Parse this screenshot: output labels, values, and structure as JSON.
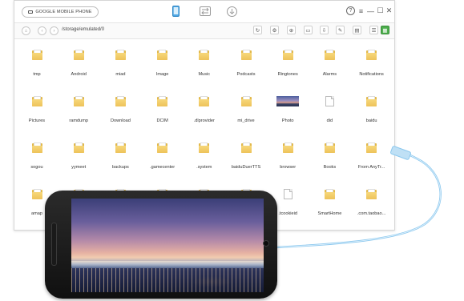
{
  "titlebar": {
    "device_name": "GOOGLE MOBILE PHONE",
    "tabs": [
      {
        "icon": "phone-icon",
        "active": true
      },
      {
        "icon": "transfer-icon",
        "active": false
      },
      {
        "icon": "download-icon",
        "active": false
      }
    ],
    "controls": {
      "help": "?",
      "menu": "≡",
      "minimize": "—",
      "maximize": "☐",
      "close": "✕"
    }
  },
  "pathbar": {
    "path": "/storage/emulated/0"
  },
  "files": [
    {
      "name": "tmp",
      "type": "folder"
    },
    {
      "name": "Android",
      "type": "folder"
    },
    {
      "name": "miad",
      "type": "folder"
    },
    {
      "name": "Image",
      "type": "folder"
    },
    {
      "name": "Music",
      "type": "folder"
    },
    {
      "name": "Podcasts",
      "type": "folder"
    },
    {
      "name": "Ringtones",
      "type": "folder"
    },
    {
      "name": "Alarms",
      "type": "folder"
    },
    {
      "name": "Notifications",
      "type": "folder"
    },
    {
      "name": "Pictures",
      "type": "folder"
    },
    {
      "name": "ramdump",
      "type": "folder"
    },
    {
      "name": "Download",
      "type": "folder"
    },
    {
      "name": "DCIM",
      "type": "folder"
    },
    {
      "name": ".dlprovider",
      "type": "folder"
    },
    {
      "name": "mi_drive",
      "type": "folder"
    },
    {
      "name": "Photo",
      "type": "image"
    },
    {
      "name": "did",
      "type": "file"
    },
    {
      "name": "baidu",
      "type": "folder"
    },
    {
      "name": "sogou",
      "type": "folder"
    },
    {
      "name": "yymeet",
      "type": "folder"
    },
    {
      "name": "backups",
      "type": "folder"
    },
    {
      "name": ".gamecenter",
      "type": "folder"
    },
    {
      "name": ".system",
      "type": "folder"
    },
    {
      "name": "baiduDuerTTS",
      "type": "folder"
    },
    {
      "name": "browser",
      "type": "folder"
    },
    {
      "name": "Books",
      "type": "folder"
    },
    {
      "name": "From AnyTr...",
      "type": "folder"
    },
    {
      "name": "amap",
      "type": "folder"
    },
    {
      "name": "",
      "type": "folder"
    },
    {
      "name": "",
      "type": "folder"
    },
    {
      "name": "",
      "type": "folder"
    },
    {
      "name": "",
      "type": "folder"
    },
    {
      "name": "",
      "type": "folder"
    },
    {
      "name": ".tcookieid",
      "type": "file"
    },
    {
      "name": "SmartHome",
      "type": "folder"
    },
    {
      "name": ".com.taobao...",
      "type": "folder"
    }
  ],
  "colors": {
    "folder": "#eec35a",
    "active_view": "#4cae4c",
    "cable": "#8cc8ee"
  }
}
